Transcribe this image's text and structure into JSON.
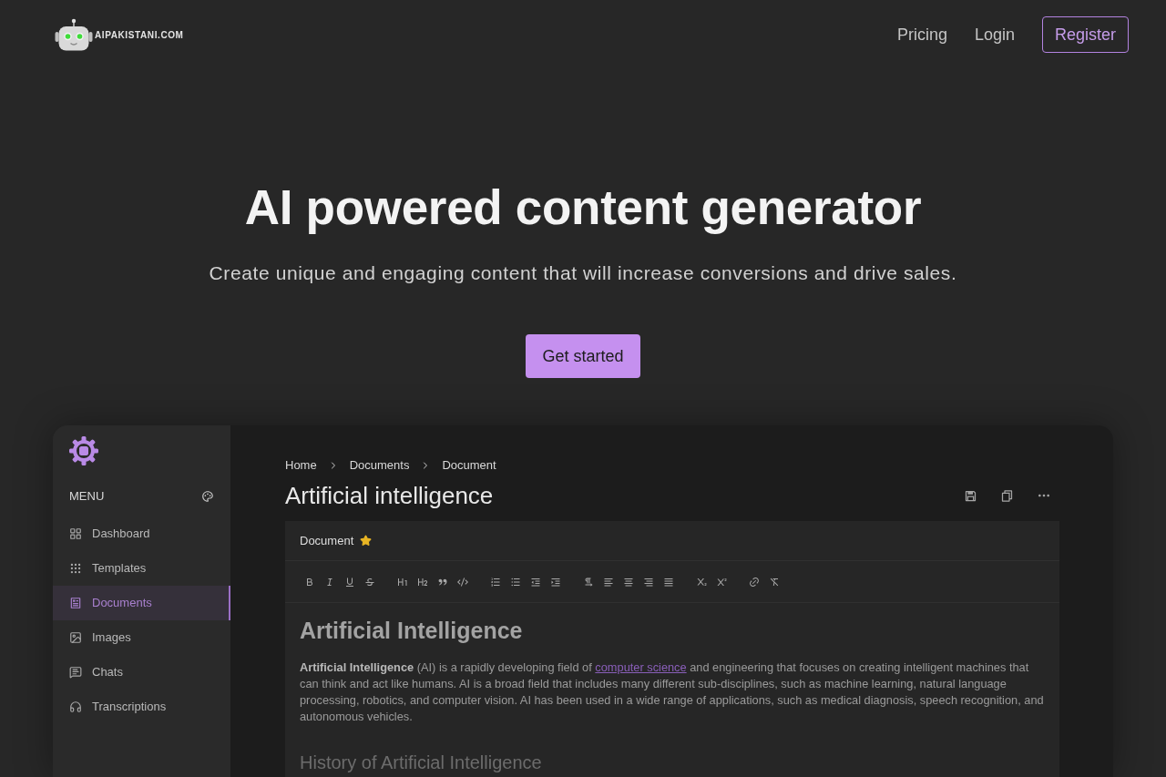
{
  "header": {
    "logo_text": "AIPAKISTANI.COM",
    "nav": [
      {
        "label": "Pricing",
        "kind": "link"
      },
      {
        "label": "Login",
        "kind": "link"
      },
      {
        "label": "Register",
        "kind": "button"
      }
    ]
  },
  "hero": {
    "title": "AI powered content generator",
    "subtitle": "Create unique and engaging content that will increase conversions and drive sales.",
    "cta": "Get started"
  },
  "app_preview": {
    "sidebar": {
      "menu_label": "MENU",
      "items": [
        {
          "label": "Dashboard",
          "selected": false
        },
        {
          "label": "Templates",
          "selected": false
        },
        {
          "label": "Documents",
          "selected": true
        },
        {
          "label": "Images",
          "selected": false
        },
        {
          "label": "Chats",
          "selected": false
        },
        {
          "label": "Transcriptions",
          "selected": false
        }
      ]
    },
    "breadcrumb": [
      "Home",
      "Documents",
      "Document"
    ],
    "title": "Artificial intelligence",
    "editor": {
      "tab_label": "Document",
      "starred": true,
      "heading": "Artificial Intelligence",
      "paragraph": {
        "before": "**Artificial Intelligence** (AI) is a rapidly developing field of",
        "link": "computer science",
        "after": "and engineering that focuses on creating intelligent machines that can think and act like humans. AI is a broad field that includes many different sub-disciplines, such as machine learning, natural language processing, robotics, and computer vision. AI has been used in a wide range of applications, such as medical diagnosis, speech recognition, and autonomous vehicles."
      },
      "subheading": "History of Artificial Intelligence"
    }
  }
}
